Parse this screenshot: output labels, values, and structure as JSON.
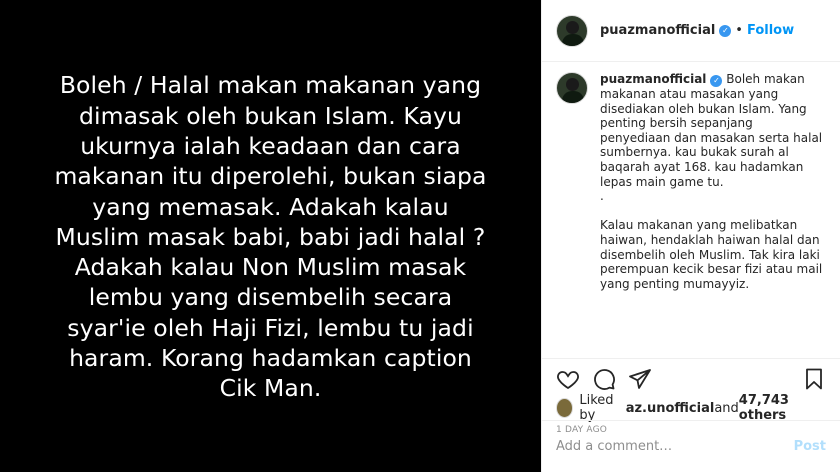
{
  "media": {
    "text": "Boleh / Halal makan makanan yang\ndimasak oleh bukan Islam. Kayu\nukurnya ialah keadaan dan cara\nmakanan itu diperolehi, bukan siapa\nyang memasak. Adakah kalau\nMuslim masak babi, babi jadi halal ?\nAdakah kalau Non Muslim masak\nlembu yang disembelih secara\nsyar'ie oleh Haji Fizi, lembu tu jadi\nharam. Korang hadamkan caption\nCik Man."
  },
  "header": {
    "username": "puazmanofficial",
    "verified_icon": "verified-badge-icon",
    "separator": "•",
    "follow_label": "Follow"
  },
  "caption": {
    "username": "puazmanofficial",
    "text": " Boleh makan makanan atau masakan yang disediakan oleh bukan Islam. Yang penting bersih sepanjang penyediaan dan masakan serta halal sumbernya. kau bukak surah al baqarah ayat 168. kau hadamkan lepas main game tu.\n.\n\nKalau makanan yang melibatkan haiwan, hendaklah haiwan halal dan disembelih oleh Muslim. Tak kira laki perempuan kecik besar fizi atau mail yang penting mumayyiz."
  },
  "actions": {
    "icons": [
      "heart-icon",
      "comment-icon",
      "share-icon",
      "bookmark-icon"
    ]
  },
  "likes": {
    "prefix": "Liked by ",
    "user": "az.unofficial",
    "middle": " and ",
    "count": "47,743 others"
  },
  "time": "1 DAY AGO",
  "comment_box": {
    "placeholder": "Add a comment…",
    "post_label": "Post"
  },
  "colors": {
    "accent": "#0095f6",
    "verified": "#3897f0",
    "post_disabled": "#b2dffc",
    "muted": "#8e8e8e"
  }
}
